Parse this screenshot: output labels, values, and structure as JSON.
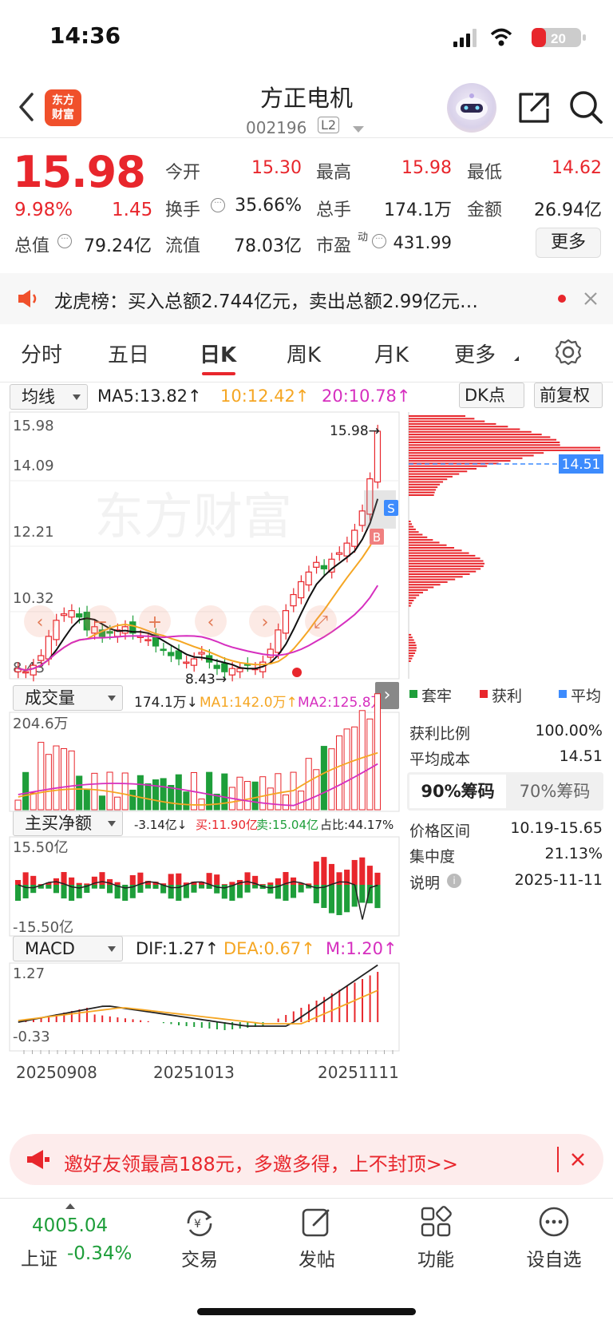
{
  "status_bar": {
    "time": "14:36",
    "battery": "20"
  },
  "nav": {
    "logo_text_line1": "东方",
    "logo_text_line2": "财富",
    "stock_name": "方正电机",
    "stock_code": "002196",
    "level_badge": "L2"
  },
  "quote": {
    "price": "15.98",
    "change_pct": "9.98%",
    "change_amt": "1.45",
    "open_label": "今开",
    "open_value": "15.30",
    "high_label": "最高",
    "high_value": "15.98",
    "low_label": "最低",
    "low_value": "14.62",
    "turnover_label": "换手",
    "turnover_value": "35.66%",
    "volume_label": "总手",
    "volume_value": "174.1万",
    "amount_label": "金额",
    "amount_value": "26.94亿",
    "mktcap_label": "总值",
    "mktcap_value": "79.24亿",
    "float_label": "流值",
    "float_value": "78.03亿",
    "pe_label": "市盈",
    "pe_sup": "动",
    "pe_value": "431.99",
    "more_button": "更多"
  },
  "news": {
    "text": "龙虎榜：买入总额2.744亿元，卖出总额2.99亿元…"
  },
  "tabs": [
    "分时",
    "五日",
    "日K",
    "周K",
    "月K",
    "更多"
  ],
  "active_tab": "日K",
  "ma_bar": {
    "select": "均线",
    "ma5": "MA5:13.82↑",
    "ma10": "10:12.42↑",
    "ma20": "20:10.78↑",
    "dk_button": "DK点",
    "adjust_button": "前复权"
  },
  "kline": {
    "y_labels": [
      "15.98",
      "14.09",
      "12.21",
      "10.32",
      "8.43"
    ],
    "max_marker": "15.98",
    "min_marker": "8.43",
    "chip_avg_marker": "14.51",
    "buy_badge": "B",
    "sell_badge": "S",
    "watermark": "东方财富"
  },
  "volume": {
    "select": "成交量",
    "value": "174.1万↓",
    "ma1": "MA1:142.0万↑",
    "ma2": "MA2:125.8万↑",
    "y_max": "204.6万"
  },
  "netflow": {
    "select": "主买净额",
    "value": "-3.14亿↓",
    "buy": "买:11.90亿",
    "sell": "卖:15.04亿",
    "ratio": "占比:44.17%",
    "y_max": "15.50亿",
    "y_min": "-15.50亿"
  },
  "macd": {
    "select": "MACD",
    "dif": "DIF:1.27↑",
    "dea": "DEA:0.67↑",
    "m": "M:1.20↑",
    "y_max": "1.27",
    "y_min": "-0.33",
    "dates": [
      "20250908",
      "20251013",
      "20251111"
    ]
  },
  "chip_panel": {
    "legend_trapped": "套牢",
    "legend_profit": "获利",
    "legend_avg": "平均",
    "profit_ratio_label": "获利比例",
    "profit_ratio_value": "100.00%",
    "avg_cost_label": "平均成本",
    "avg_cost_value": "14.51",
    "tab90": "90%筹码",
    "tab70": "70%筹码",
    "price_range_label": "价格区间",
    "price_range_value": "10.19-15.65",
    "concentration_label": "集中度",
    "concentration_value": "21.13%",
    "note_label": "说明",
    "note_value": "2025-11-11"
  },
  "invite": {
    "text": "邀好友领最高188元，多邀多得，上不封顶>>"
  },
  "bottom_bar": {
    "index_value": "4005.04",
    "index_name": "上证",
    "index_change": "-0.34%",
    "items": [
      "交易",
      "发帖",
      "功能",
      "设自选"
    ]
  },
  "colors": {
    "up": "#e8262c",
    "down": "#1e9e3a",
    "ma10": "#f5a623",
    "ma20": "#d62fbf",
    "avg": "#3d8bfd"
  }
}
